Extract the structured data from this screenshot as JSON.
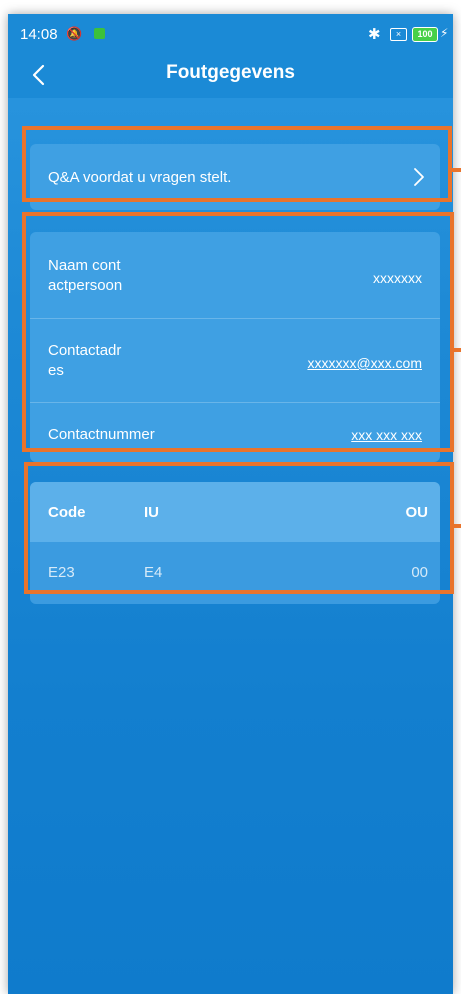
{
  "status_bar": {
    "time": "14:08",
    "battery": "100"
  },
  "header": {
    "title": "Foutgegevens"
  },
  "qa": {
    "text": "Q&A voordat u vragen stelt."
  },
  "contact": {
    "name_label_line1": "Naam cont",
    "name_label_line2": "actpersoon",
    "name_value": "xxxxxxx",
    "address_label_line1": "Contactadr",
    "address_label_line2": "es",
    "address_value": "xxxxxxx@xxx.com",
    "number_label": "Contactnummer",
    "number_value": "xxx xxx xxx"
  },
  "error_table": {
    "headers": [
      "Code",
      "IU",
      "OU"
    ],
    "rows": [
      [
        "E23",
        "E4",
        "00"
      ]
    ]
  },
  "colors": {
    "highlight": "#e9742c",
    "background": "#1b8ad6",
    "card": "#3fa0e3"
  }
}
